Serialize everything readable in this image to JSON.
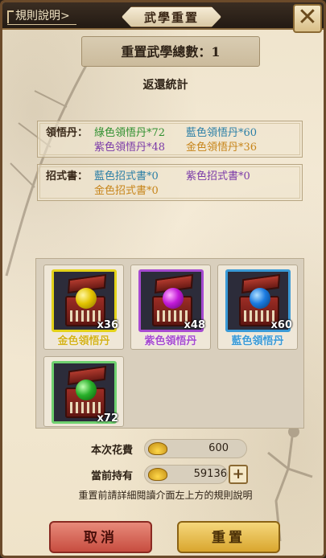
{
  "header": {
    "rules_label": "規則說明>",
    "title": "武學重置"
  },
  "summary": {
    "total_label": "重置武學總數：1",
    "return_title": "返還統計"
  },
  "pills": {
    "label": "領悟丹：",
    "items": [
      "綠色領悟丹*72",
      "藍色領悟丹*60",
      "紫色領悟丹*48",
      "金色領悟丹*36"
    ]
  },
  "scrolls": {
    "label": "招式書：",
    "items": [
      "藍色招式書*0",
      "紫色招式書*0",
      "金色招式書*0"
    ]
  },
  "rewards": [
    {
      "name": "金色領悟丹",
      "qty": "x36",
      "color": "#d4b21a",
      "orb": "#e3c400"
    },
    {
      "name": "紫色領悟丹",
      "qty": "x48",
      "color": "#a64ad0",
      "orb": "#c21ad8"
    },
    {
      "name": "藍色領悟丹",
      "qty": "x60",
      "color": "#3a9ad6",
      "orb": "#1a7ae0"
    },
    {
      "name": "",
      "qty": "x72",
      "color": "#6fd06f",
      "orb": "#28b02a"
    }
  ],
  "cost": {
    "spend_label": "本次花費",
    "spend_value": "600",
    "hold_label": "當前持有",
    "hold_value": "59136"
  },
  "note": "重置前請詳細閱讀介面左上方的規則說明",
  "buttons": {
    "cancel": "取消",
    "reset": "重置"
  }
}
